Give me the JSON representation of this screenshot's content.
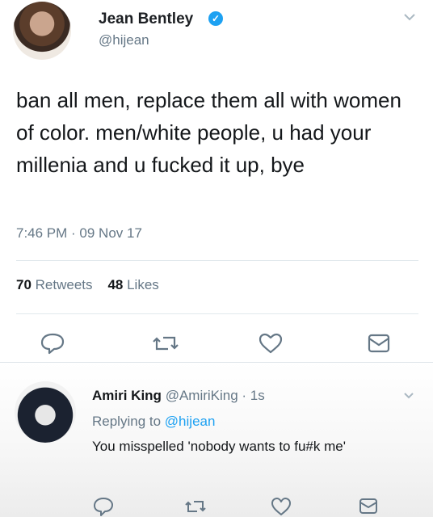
{
  "tweet": {
    "author_name": "Jean Bentley",
    "author_handle": "@hijean",
    "text": "ban all men, replace them all with women of color. men/white people, u had your millenia and u fucked it up, bye",
    "timestamp": "7:46 PM · 09 Nov 17",
    "retweets_count": "70",
    "retweets_label": "Retweets",
    "likes_count": "48",
    "likes_label": "Likes"
  },
  "reply": {
    "author_name": "Amiri King",
    "author_handle": "@AmiriKing",
    "time": "· 1s",
    "replying_prefix": "Replying to",
    "replying_handle": "@hijean",
    "text": "You misspelled 'nobody wants to fu#k me'"
  },
  "icons": {
    "verified": "verified-badge-icon",
    "reply": "reply-icon",
    "retweet": "retweet-icon",
    "like": "heart-icon",
    "message": "envelope-icon",
    "chevron": "chevron-down-icon"
  },
  "colors": {
    "link": "#1da1f2",
    "secondary_text": "#657786",
    "primary_text": "#14171a"
  }
}
